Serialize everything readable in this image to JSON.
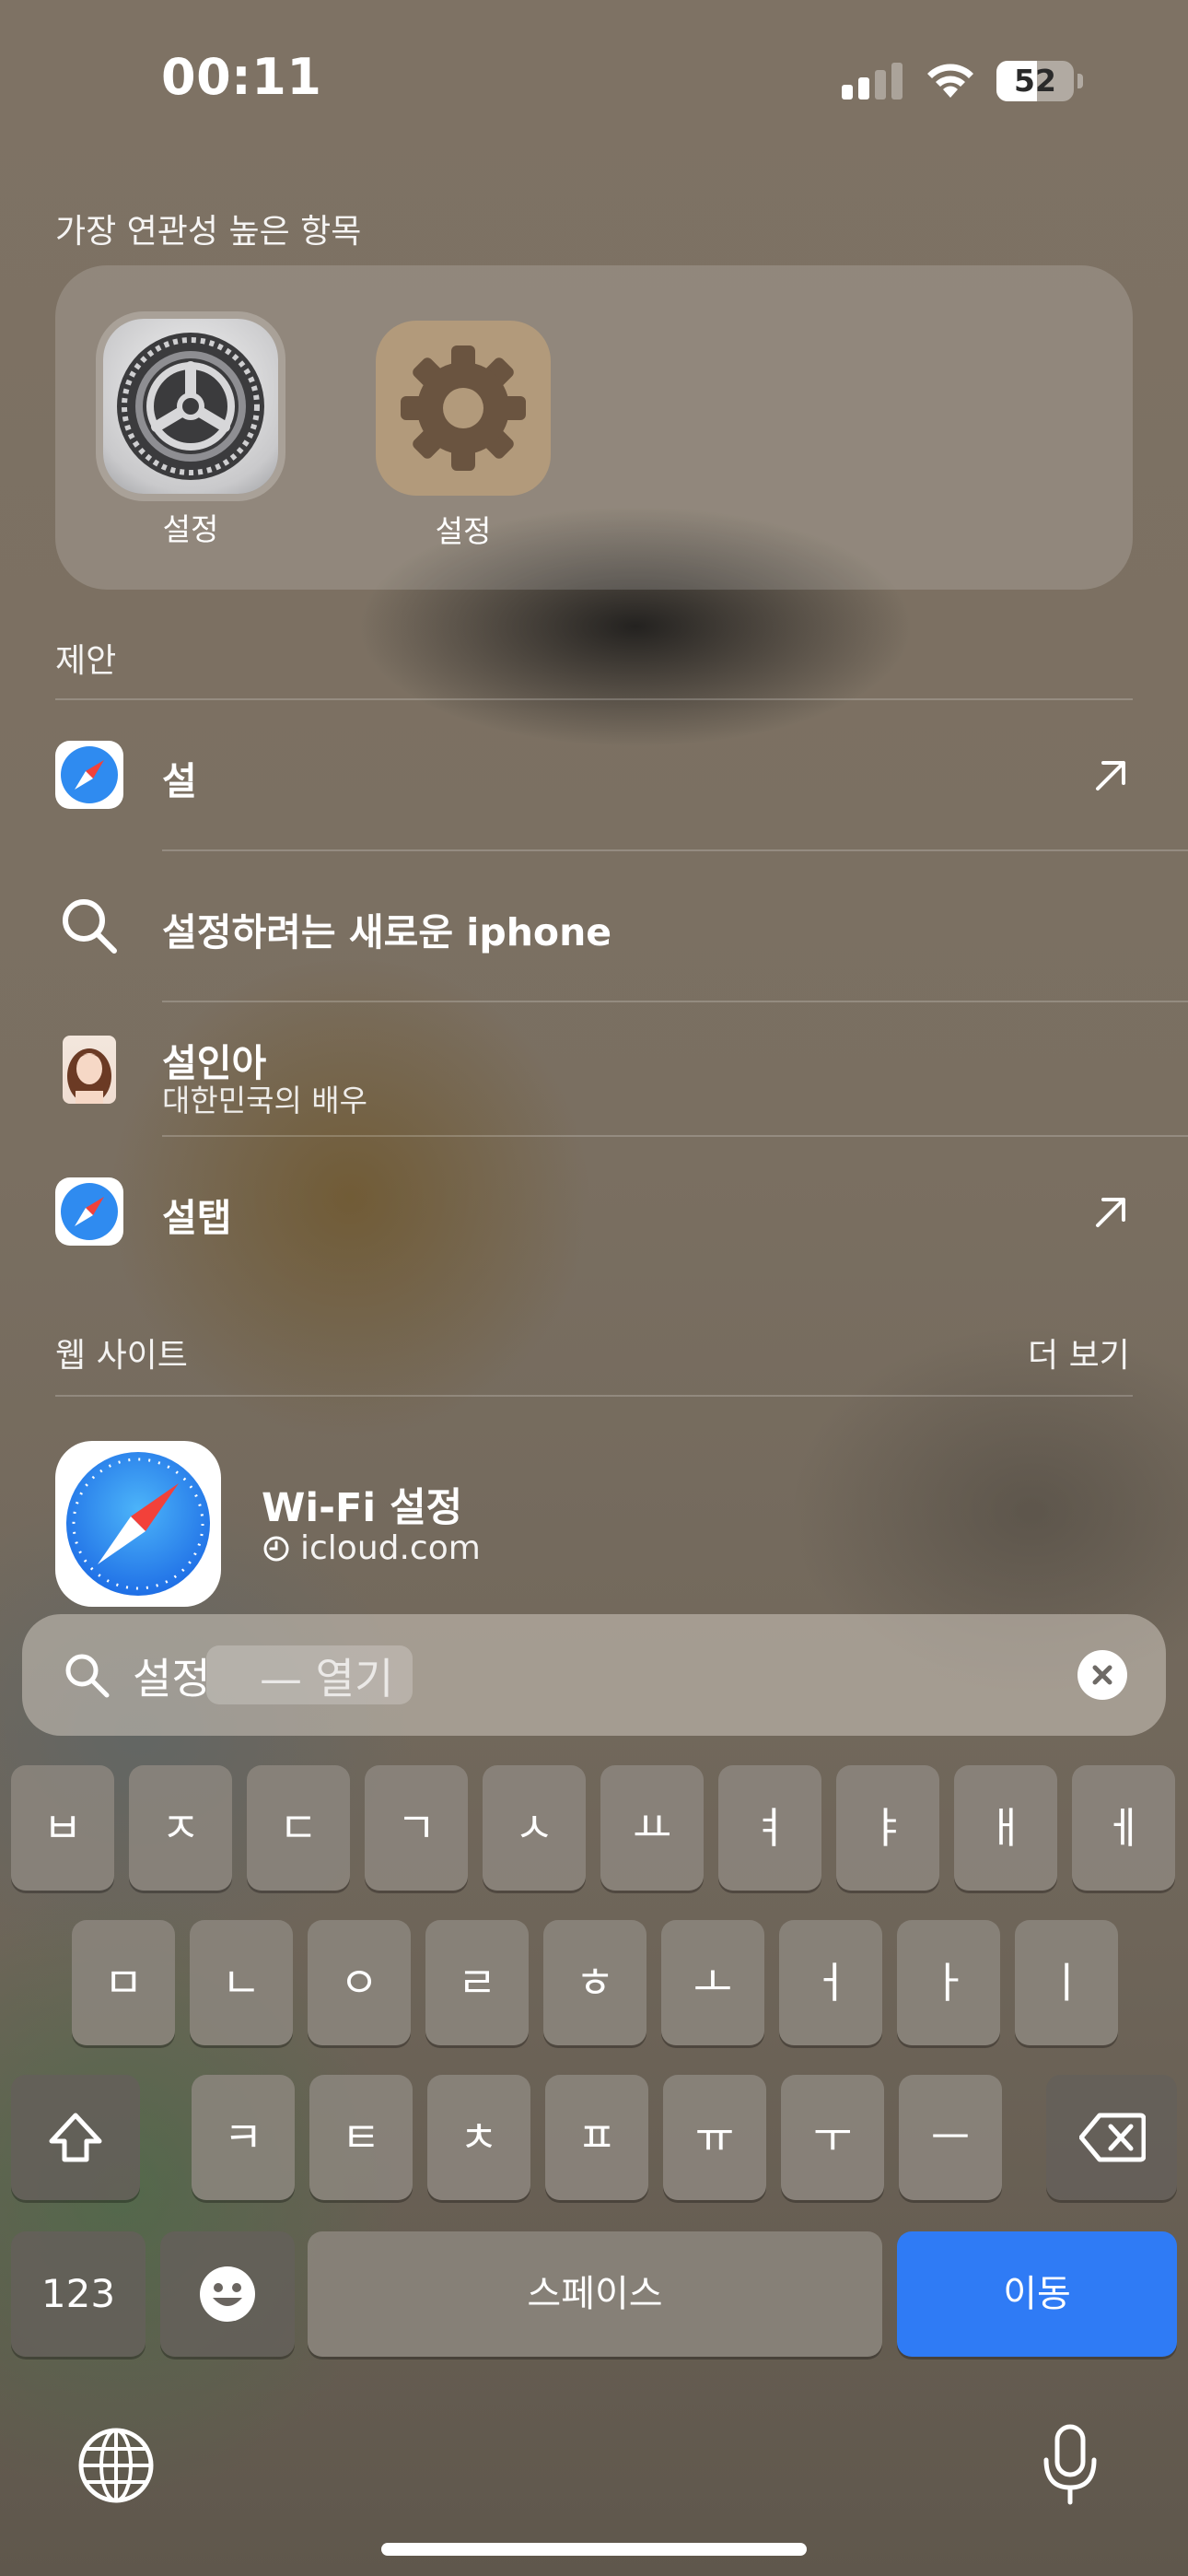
{
  "status_bar": {
    "time": "00:11",
    "battery": "52",
    "battery_fraction": 0.52,
    "signal_bars_active": 2,
    "signal_bars_total": 4
  },
  "top_hits": {
    "heading": "가장 연관성 높은 항목",
    "apps": [
      {
        "label": "설정",
        "icon": "settings-gear-icon"
      },
      {
        "label": "설정",
        "icon": "gear-icon"
      }
    ]
  },
  "suggestions": {
    "heading": "제안",
    "items": [
      {
        "title": "설",
        "icon": "safari-icon",
        "action": "arrow-up-right-icon"
      },
      {
        "title": "설정하려는 새로운 iphone",
        "icon": "search-icon"
      },
      {
        "title": "설인아",
        "subtitle": "대한민국의 배우",
        "icon": "person-photo"
      },
      {
        "title": "설탭",
        "icon": "safari-icon",
        "action": "arrow-up-right-icon"
      }
    ]
  },
  "websites": {
    "heading": "웹 사이트",
    "more_label": "더 보기",
    "items": [
      {
        "title": "Wi-Fi 설정",
        "subtitle": "icloud.com",
        "icon": "safari-icon",
        "history_icon": "clock-icon"
      }
    ]
  },
  "search": {
    "query": "설정",
    "hint": "— 열기",
    "clear_icon": "clear-icon"
  },
  "keyboard": {
    "row1": [
      "ㅂ",
      "ㅈ",
      "ㄷ",
      "ㄱ",
      "ㅅ",
      "ㅛ",
      "ㅕ",
      "ㅑ",
      "ㅐ",
      "ㅔ"
    ],
    "row2": [
      "ㅁ",
      "ㄴ",
      "ㅇ",
      "ㄹ",
      "ㅎ",
      "ㅗ",
      "ㅓ",
      "ㅏ",
      "ㅣ"
    ],
    "row3": [
      "ㅋ",
      "ㅌ",
      "ㅊ",
      "ㅍ",
      "ㅠ",
      "ㅜ",
      "ㅡ"
    ],
    "numbers_label": "123",
    "space_label": "스페이스",
    "go_label": "이동",
    "accent_color": "#2f7bf5"
  }
}
